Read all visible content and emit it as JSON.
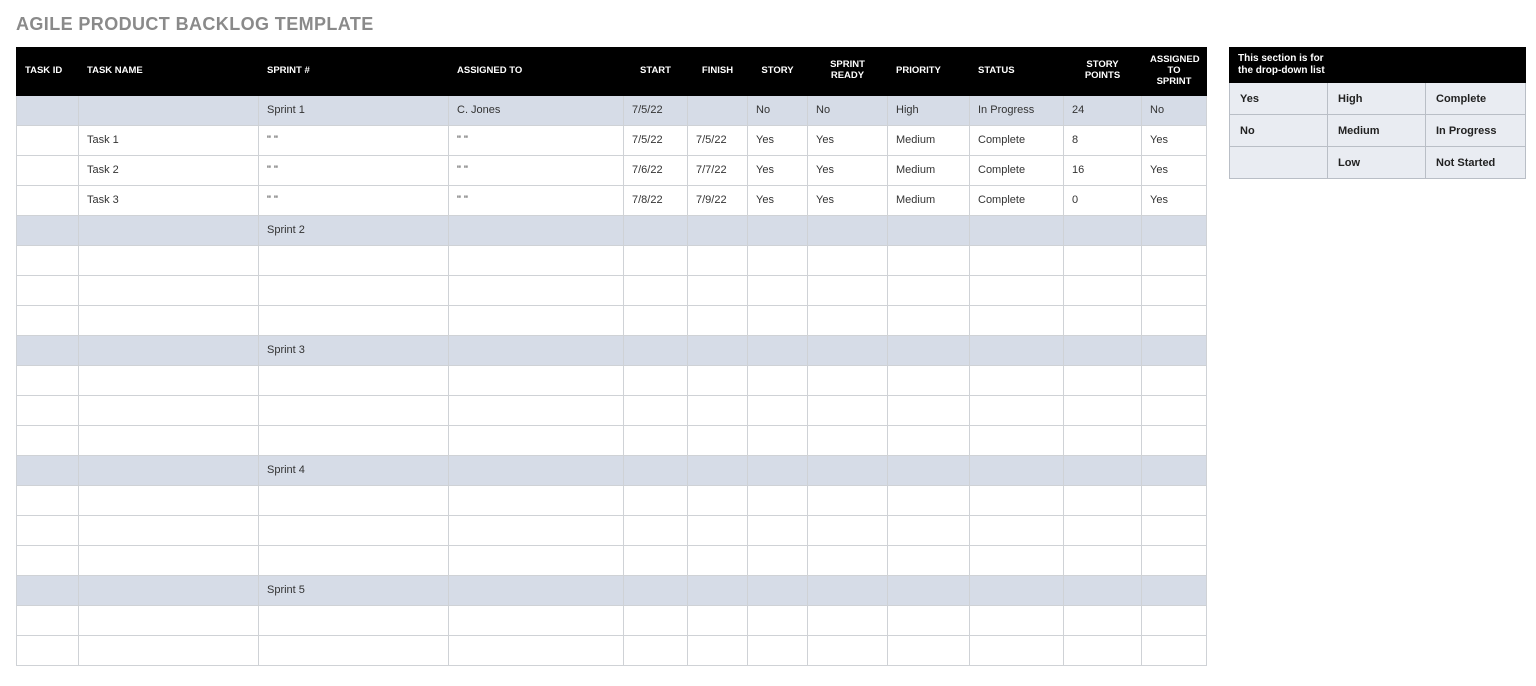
{
  "title": "AGILE PRODUCT BACKLOG TEMPLATE",
  "headers": {
    "task_id": "TASK ID",
    "task_name": "TASK NAME",
    "sprint": "SPRINT #",
    "assigned": "ASSIGNED TO",
    "start": "START",
    "finish": "FINISH",
    "story": "STORY",
    "sprint_ready": "SPRINT READY",
    "priority": "PRIORITY",
    "status": "STATUS",
    "points": "STORY POINTS",
    "to_sprint": "ASSIGNED TO SPRINT"
  },
  "rows": [
    {
      "shade": true,
      "task_id": "",
      "task_name": "",
      "sprint": "Sprint 1",
      "assigned": "C. Jones",
      "start": "7/5/22",
      "finish": "",
      "story": "No",
      "ready": "No",
      "priority": "High",
      "status": "In Progress",
      "points": "24",
      "to_sprint": "No"
    },
    {
      "shade": false,
      "task_id": "",
      "task_name": "Task 1",
      "sprint": "\" \"",
      "assigned": "\" \"",
      "start": "7/5/22",
      "finish": "7/5/22",
      "story": "Yes",
      "ready": "Yes",
      "priority": "Medium",
      "status": "Complete",
      "points": "8",
      "to_sprint": "Yes"
    },
    {
      "shade": false,
      "task_id": "",
      "task_name": "Task 2",
      "sprint": "\" \"",
      "assigned": "\" \"",
      "start": "7/6/22",
      "finish": "7/7/22",
      "story": "Yes",
      "ready": "Yes",
      "priority": "Medium",
      "status": "Complete",
      "points": "16",
      "to_sprint": "Yes"
    },
    {
      "shade": false,
      "task_id": "",
      "task_name": "Task 3",
      "sprint": "\" \"",
      "assigned": "\" \"",
      "start": "7/8/22",
      "finish": "7/9/22",
      "story": "Yes",
      "ready": "Yes",
      "priority": "Medium",
      "status": "Complete",
      "points": "0",
      "to_sprint": "Yes"
    },
    {
      "shade": true,
      "task_id": "",
      "task_name": "",
      "sprint": "Sprint 2",
      "assigned": "",
      "start": "",
      "finish": "",
      "story": "",
      "ready": "",
      "priority": "",
      "status": "",
      "points": "",
      "to_sprint": ""
    },
    {
      "shade": false,
      "task_id": "",
      "task_name": "",
      "sprint": "",
      "assigned": "",
      "start": "",
      "finish": "",
      "story": "",
      "ready": "",
      "priority": "",
      "status": "",
      "points": "",
      "to_sprint": ""
    },
    {
      "shade": false,
      "task_id": "",
      "task_name": "",
      "sprint": "",
      "assigned": "",
      "start": "",
      "finish": "",
      "story": "",
      "ready": "",
      "priority": "",
      "status": "",
      "points": "",
      "to_sprint": ""
    },
    {
      "shade": false,
      "task_id": "",
      "task_name": "",
      "sprint": "",
      "assigned": "",
      "start": "",
      "finish": "",
      "story": "",
      "ready": "",
      "priority": "",
      "status": "",
      "points": "",
      "to_sprint": ""
    },
    {
      "shade": true,
      "task_id": "",
      "task_name": "",
      "sprint": "Sprint 3",
      "assigned": "",
      "start": "",
      "finish": "",
      "story": "",
      "ready": "",
      "priority": "",
      "status": "",
      "points": "",
      "to_sprint": ""
    },
    {
      "shade": false,
      "task_id": "",
      "task_name": "",
      "sprint": "",
      "assigned": "",
      "start": "",
      "finish": "",
      "story": "",
      "ready": "",
      "priority": "",
      "status": "",
      "points": "",
      "to_sprint": ""
    },
    {
      "shade": false,
      "task_id": "",
      "task_name": "",
      "sprint": "",
      "assigned": "",
      "start": "",
      "finish": "",
      "story": "",
      "ready": "",
      "priority": "",
      "status": "",
      "points": "",
      "to_sprint": ""
    },
    {
      "shade": false,
      "task_id": "",
      "task_name": "",
      "sprint": "",
      "assigned": "",
      "start": "",
      "finish": "",
      "story": "",
      "ready": "",
      "priority": "",
      "status": "",
      "points": "",
      "to_sprint": ""
    },
    {
      "shade": true,
      "task_id": "",
      "task_name": "",
      "sprint": "Sprint 4",
      "assigned": "",
      "start": "",
      "finish": "",
      "story": "",
      "ready": "",
      "priority": "",
      "status": "",
      "points": "",
      "to_sprint": ""
    },
    {
      "shade": false,
      "task_id": "",
      "task_name": "",
      "sprint": "",
      "assigned": "",
      "start": "",
      "finish": "",
      "story": "",
      "ready": "",
      "priority": "",
      "status": "",
      "points": "",
      "to_sprint": ""
    },
    {
      "shade": false,
      "task_id": "",
      "task_name": "",
      "sprint": "",
      "assigned": "",
      "start": "",
      "finish": "",
      "story": "",
      "ready": "",
      "priority": "",
      "status": "",
      "points": "",
      "to_sprint": ""
    },
    {
      "shade": false,
      "task_id": "",
      "task_name": "",
      "sprint": "",
      "assigned": "",
      "start": "",
      "finish": "",
      "story": "",
      "ready": "",
      "priority": "",
      "status": "",
      "points": "",
      "to_sprint": ""
    },
    {
      "shade": true,
      "task_id": "",
      "task_name": "",
      "sprint": "Sprint 5",
      "assigned": "",
      "start": "",
      "finish": "",
      "story": "",
      "ready": "",
      "priority": "",
      "status": "",
      "points": "",
      "to_sprint": ""
    },
    {
      "shade": false,
      "task_id": "",
      "task_name": "",
      "sprint": "",
      "assigned": "",
      "start": "",
      "finish": "",
      "story": "",
      "ready": "",
      "priority": "",
      "status": "",
      "points": "",
      "to_sprint": ""
    },
    {
      "shade": false,
      "task_id": "",
      "task_name": "",
      "sprint": "",
      "assigned": "",
      "start": "",
      "finish": "",
      "story": "",
      "ready": "",
      "priority": "",
      "status": "",
      "points": "",
      "to_sprint": ""
    }
  ],
  "dropdown": {
    "heading": "This section is for\nthe drop-down list",
    "rows": [
      {
        "a": "Yes",
        "b": "High",
        "c": "Complete"
      },
      {
        "a": "No",
        "b": "Medium",
        "c": "In Progress"
      },
      {
        "a": "",
        "b": "Low",
        "c": "Not Started"
      }
    ]
  }
}
